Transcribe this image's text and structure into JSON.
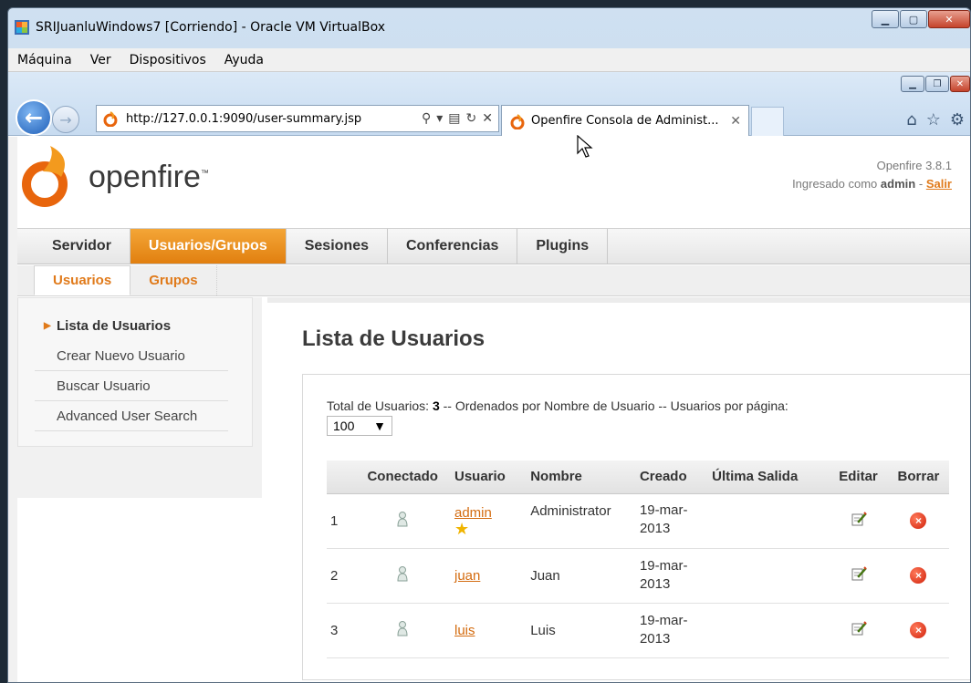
{
  "vbox": {
    "title": "SRIJuanluWindows7 [Corriendo] - Oracle VM VirtualBox",
    "menu": [
      "Máquina",
      "Ver",
      "Dispositivos",
      "Ayuda"
    ]
  },
  "browser": {
    "url": "http://127.0.0.1:9090/user-summary.jsp",
    "tab_label": "Openfire Consola de Administ...",
    "tab_close": "✕"
  },
  "header": {
    "logo_text": "openfire",
    "logo_tm": "™",
    "version": "Openfire 3.8.1",
    "logged_in_prefix": "Ingresado como",
    "user": "admin",
    "separator": "-",
    "logout": "Salir"
  },
  "main_tabs": [
    "Servidor",
    "Usuarios/Grupos",
    "Sesiones",
    "Conferencias",
    "Plugins"
  ],
  "sub_tabs": [
    "Usuarios",
    "Grupos"
  ],
  "sidebar": {
    "items": [
      "Lista de Usuarios",
      "Crear Nuevo Usuario",
      "Buscar Usuario",
      "Advanced User Search"
    ]
  },
  "content": {
    "title": "Lista de Usuarios",
    "totals_prefix": "Total de Usuarios:",
    "totals_count": "3",
    "totals_suffix": "-- Ordenados por Nombre de Usuario -- Usuarios por página:",
    "per_page": "100"
  },
  "table": {
    "headers": [
      "",
      "Conectado",
      "Usuario",
      "Nombre",
      "Creado",
      "Última Salida",
      "Editar",
      "Borrar"
    ],
    "rows": [
      {
        "num": "1",
        "user": "admin",
        "name": "Administrator",
        "created_1": "19-mar-",
        "created_2": "2013",
        "last": ""
      },
      {
        "num": "2",
        "user": "juan",
        "name": "Juan",
        "created_1": "19-mar-",
        "created_2": "2013",
        "last": ""
      },
      {
        "num": "3",
        "user": "luis",
        "name": "Luis",
        "created_1": "19-mar-",
        "created_2": "2013",
        "last": ""
      }
    ]
  },
  "colors": {
    "accent_orange": "#e17f0f",
    "link_orange": "#d46c10"
  }
}
